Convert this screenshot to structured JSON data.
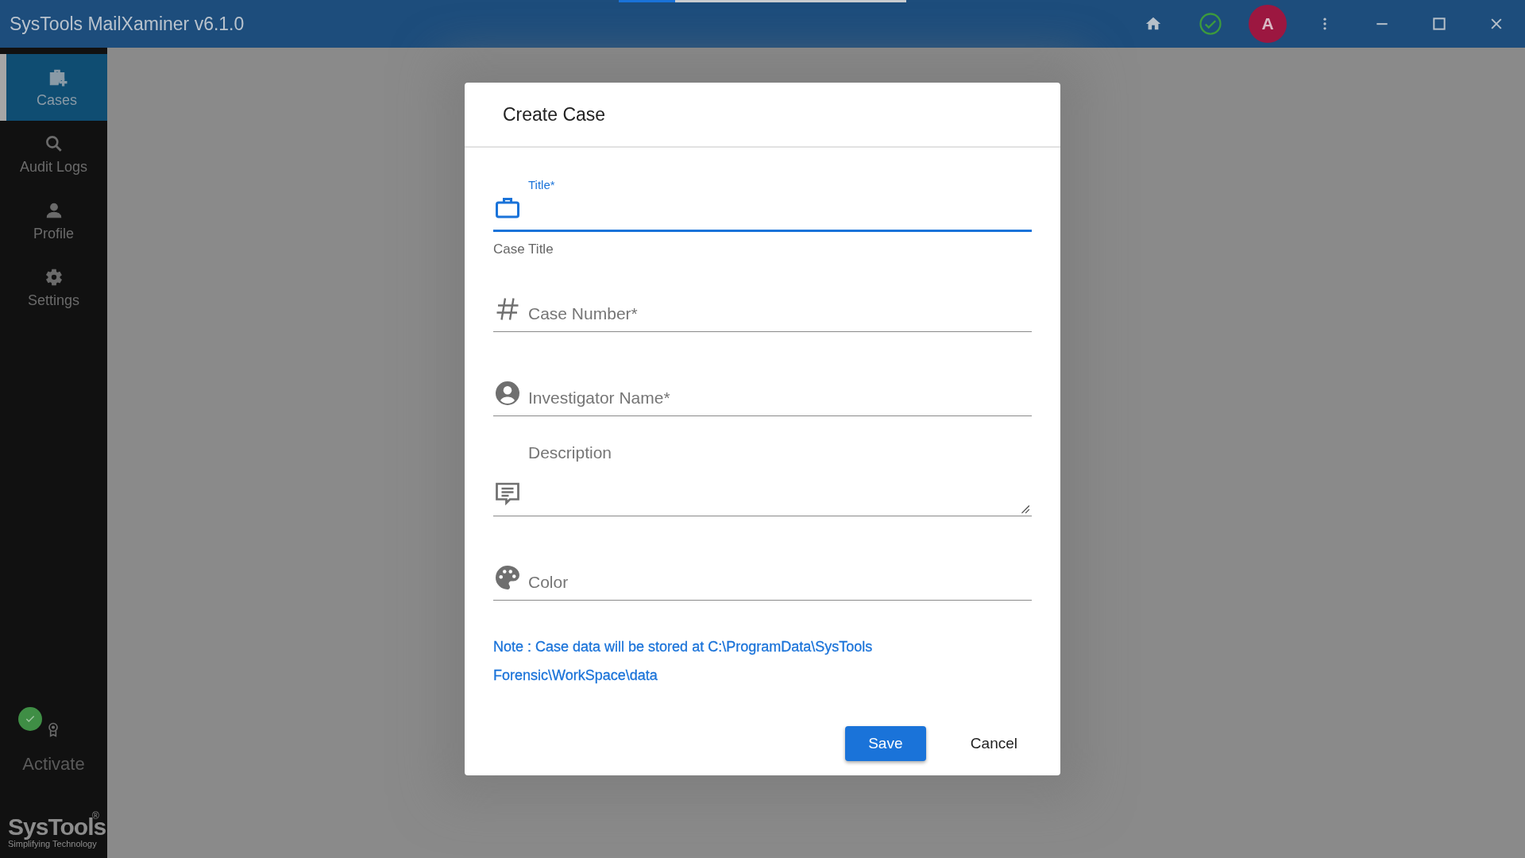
{
  "window": {
    "title": "SysTools MailXaminer v6.1.0",
    "avatar_letter": "A"
  },
  "sidebar": {
    "items": [
      {
        "label": "Cases",
        "selected": true
      },
      {
        "label": "Audit Logs",
        "selected": false
      },
      {
        "label": "Profile",
        "selected": false
      },
      {
        "label": "Settings",
        "selected": false
      }
    ],
    "activate": {
      "label": "Activate",
      "activated": true
    },
    "logo": {
      "name": "SysTools",
      "mark": "®",
      "tagline": "Simplifying Technology"
    }
  },
  "dialog": {
    "title": "Create Case",
    "fields": [
      {
        "kind": "text",
        "label": "Title*",
        "hint": "Case Title",
        "focused": true
      },
      {
        "kind": "text",
        "label": "Case Number*",
        "focused": false
      },
      {
        "kind": "text",
        "label": "Investigator Name*",
        "focused": false
      },
      {
        "kind": "textarea",
        "label": "Description",
        "focused": false
      },
      {
        "kind": "text",
        "label": "Color",
        "focused": false
      }
    ],
    "note": [
      "Note : Case data will be stored at C:\\ProgramData\\SysTools",
      "Forensic\\WorkSpace\\data"
    ],
    "buttons": [
      {
        "label": "Save",
        "kind": "primary"
      },
      {
        "label": "Cancel",
        "kind": "flat"
      }
    ]
  }
}
